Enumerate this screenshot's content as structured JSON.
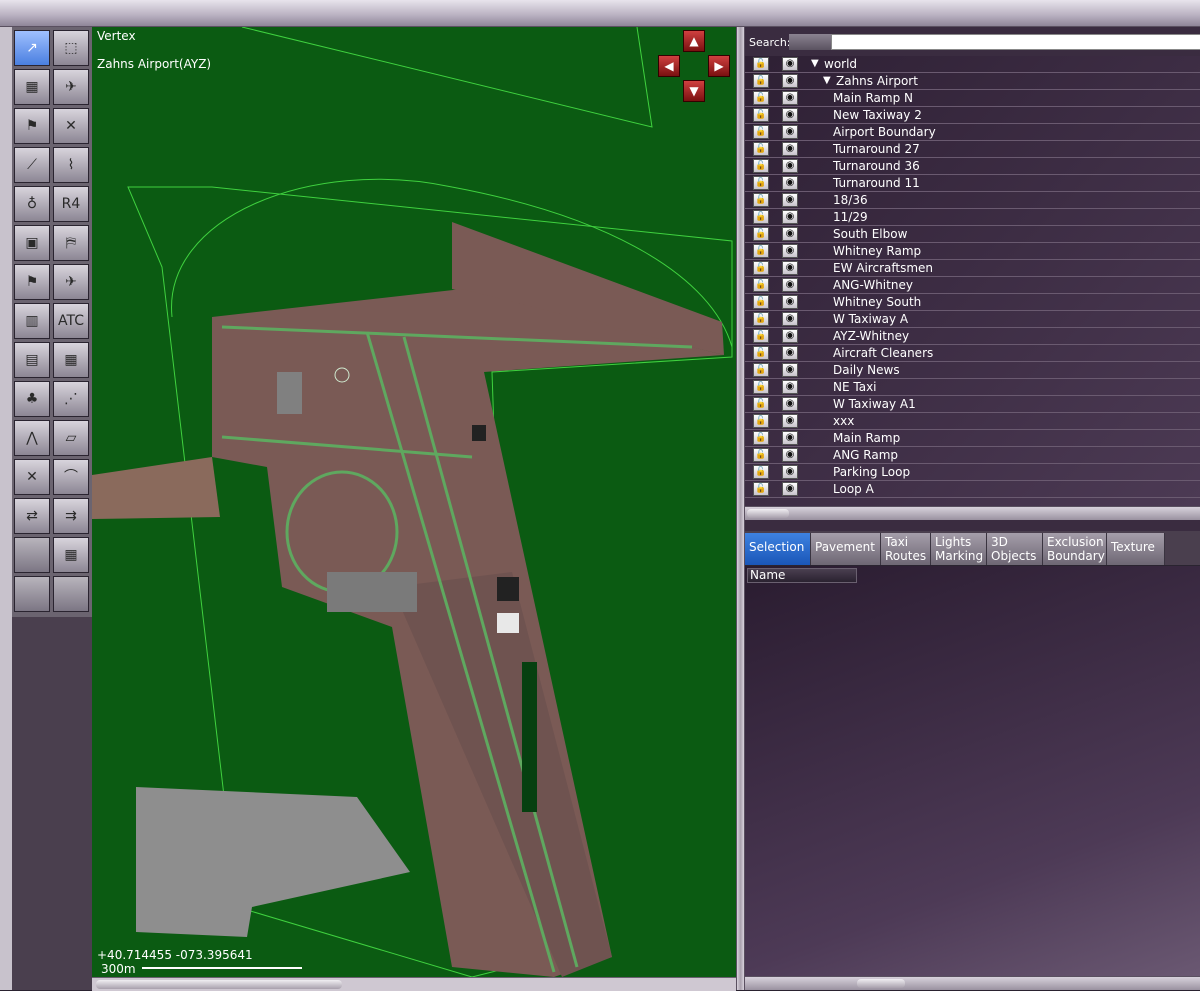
{
  "colors": {
    "map_background": "#0b5b12",
    "overlay_lines": "#3fd13f",
    "pavement": "#7a5a55",
    "panel_background": "#3a2c40",
    "selected_tab": "#2a6ad0",
    "selected_tool": "#5a8ff0"
  },
  "map": {
    "mode_label": "Vertex",
    "airport_label": "Zahns Airport(AYZ)",
    "coordinates": "+40.714455 -073.395641",
    "scale_label": "300m",
    "nav_icons": [
      "rotate-up-icon",
      "rotate-left-icon",
      "rotate-right-icon",
      "rotate-down-icon"
    ]
  },
  "toolbar": {
    "tools": [
      {
        "name": "vertex-tool-icon",
        "selected": true
      },
      {
        "name": "marquee-tool-icon"
      },
      {
        "name": "runway-tool-icon"
      },
      {
        "name": "helipad-tool-icon"
      },
      {
        "name": "ramp-start-tool-icon"
      },
      {
        "name": "taxiway-tool-icon"
      },
      {
        "name": "taxi-route-tool-icon"
      },
      {
        "name": "taxiway-line-tool-icon"
      },
      {
        "name": "light-fixture-tool-icon"
      },
      {
        "name": "taxi-sign-tool-icon"
      },
      {
        "name": "object-tool-icon"
      },
      {
        "name": "windsock-tool-icon"
      },
      {
        "name": "beacon-tool-icon"
      },
      {
        "name": "ramp-plane-tool-icon"
      },
      {
        "name": "facade-tool-icon"
      },
      {
        "name": "atc-tool-icon"
      },
      {
        "name": "building-tool-icon"
      },
      {
        "name": "building-alt-tool-icon"
      },
      {
        "name": "forest-tool-icon"
      },
      {
        "name": "point-tool-icon"
      },
      {
        "name": "line-tool-icon"
      },
      {
        "name": "polygon-tool-icon"
      },
      {
        "name": "exclusion-tool-icon"
      },
      {
        "name": "road-tool-icon"
      },
      {
        "name": "flow-tool-icon"
      },
      {
        "name": "taxi-flow-tool-icon"
      },
      {
        "name": "empty-tool-1"
      },
      {
        "name": "autogen-tool-icon"
      },
      {
        "name": "empty-tool-2"
      },
      {
        "name": "empty-tool-3"
      }
    ]
  },
  "search": {
    "label": "Search:",
    "value": ""
  },
  "tree": {
    "items": [
      {
        "label": "world",
        "level": 0,
        "expanded": true
      },
      {
        "label": "Zahns Airport",
        "level": 1,
        "expanded": true
      },
      {
        "label": "Main Ramp N",
        "level": 2
      },
      {
        "label": "New Taxiway 2",
        "level": 2
      },
      {
        "label": "Airport Boundary",
        "level": 2
      },
      {
        "label": "Turnaround 27",
        "level": 2
      },
      {
        "label": "Turnaround 36",
        "level": 2
      },
      {
        "label": "Turnaround 11",
        "level": 2
      },
      {
        "label": "18/36",
        "level": 2
      },
      {
        "label": "11/29",
        "level": 2
      },
      {
        "label": "South Elbow",
        "level": 2
      },
      {
        "label": "Whitney Ramp",
        "level": 2
      },
      {
        "label": "EW Aircraftsmen",
        "level": 2
      },
      {
        "label": "ANG-Whitney",
        "level": 2
      },
      {
        "label": "Whitney South",
        "level": 2
      },
      {
        "label": "W Taxiway A",
        "level": 2
      },
      {
        "label": "AYZ-Whitney",
        "level": 2
      },
      {
        "label": "Aircraft Cleaners",
        "level": 2
      },
      {
        "label": "Daily News",
        "level": 2
      },
      {
        "label": "NE Taxi",
        "level": 2
      },
      {
        "label": "W Taxiway A1",
        "level": 2
      },
      {
        "label": "xxx",
        "level": 2
      },
      {
        "label": "Main Ramp",
        "level": 2
      },
      {
        "label": "ANG Ramp",
        "level": 2
      },
      {
        "label": "Parking Loop",
        "level": 2
      },
      {
        "label": "Loop A",
        "level": 2
      }
    ]
  },
  "tabs": [
    {
      "label": "Selection",
      "active": true
    },
    {
      "label": "Pavement"
    },
    {
      "label": "Taxi\nRoutes"
    },
    {
      "label": "Lights\nMarking"
    },
    {
      "label": "3D\nObjects"
    },
    {
      "label": "Exclusion\nBoundary"
    },
    {
      "label": "Texture"
    }
  ],
  "attributes": {
    "column_name": "Name"
  }
}
